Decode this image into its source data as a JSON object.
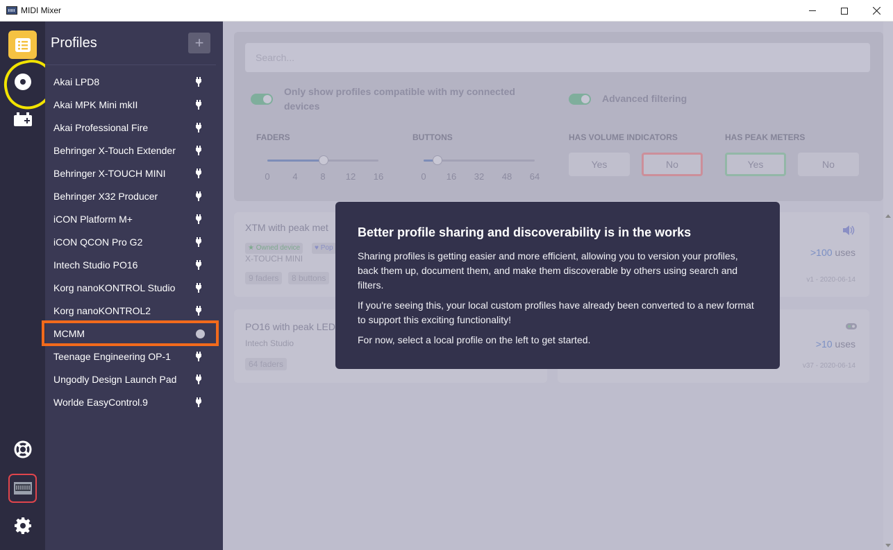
{
  "window": {
    "title": "MIDI Mixer"
  },
  "rail": {
    "items": [
      "profiles-icon",
      "mixer-icon",
      "devices-icon",
      "help-icon",
      "device-image-icon",
      "settings-icon"
    ]
  },
  "sidebar": {
    "title": "Profiles",
    "add_label": "+",
    "items": [
      {
        "label": "Akai LPD8",
        "status": "plug"
      },
      {
        "label": "Akai MPK Mini mkII",
        "status": "plug"
      },
      {
        "label": "Akai Professional Fire",
        "status": "plug"
      },
      {
        "label": "Behringer X-Touch Extender",
        "status": "plug"
      },
      {
        "label": "Behringer X-TOUCH MINI",
        "status": "plug"
      },
      {
        "label": "Behringer X32 Producer",
        "status": "plug"
      },
      {
        "label": "iCON Platform M+",
        "status": "plug"
      },
      {
        "label": "iCON QCON Pro G2",
        "status": "plug"
      },
      {
        "label": "Intech Studio PO16",
        "status": "plug"
      },
      {
        "label": "Korg nanoKONTROL Studio",
        "status": "plug"
      },
      {
        "label": "Korg nanoKONTROL2",
        "status": "plug"
      },
      {
        "label": "MCMM",
        "status": "dot",
        "selected": true
      },
      {
        "label": "Teenage Engineering OP-1",
        "status": "plug"
      },
      {
        "label": "Ungodly Design Launch Pad",
        "status": "plug"
      },
      {
        "label": "Worlde EasyControl.9",
        "status": "plug"
      }
    ]
  },
  "filters": {
    "search_placeholder": "Search...",
    "compat_label": "Only show profiles compatible with my connected devices",
    "advanced_label": "Advanced filtering",
    "faders_head": "FADERS",
    "faders_ticks": [
      "0",
      "4",
      "8",
      "12",
      "16"
    ],
    "buttons_head": "BUTTONS",
    "buttons_ticks": [
      "0",
      "16",
      "32",
      "48",
      "64"
    ],
    "volume_head": "HAS VOLUME INDICATORS",
    "volume_yes": "Yes",
    "volume_no": "No",
    "peak_head": "HAS PEAK METERS",
    "peak_yes": "Yes",
    "peak_no": "No"
  },
  "cards": [
    {
      "title": "XTM with peak met",
      "tag_owned": "Owned device",
      "tag_popular": "Pop",
      "subtitle": "X-TOUCH MINI",
      "chip1": "9 faders",
      "chip2": "8 buttons",
      "uses_num": ">100",
      "uses_word": "uses",
      "version": "v1 - 2020-06-14"
    },
    {
      "title": "PO16 with peak LED",
      "subtitle": "Intech Studio",
      "chip1": "64 faders",
      "uses_num": ">10",
      "uses_word": "uses",
      "version": "v37 - 2020-06-14"
    }
  ],
  "modal": {
    "title": "Better profile sharing and discoverability is in the works",
    "p1": "Sharing profiles is getting easier and more efficient, allowing you to version your profiles, back them up, document them, and make them discoverable by others using search and filters.",
    "p2": "If you're seeing this, your local custom profiles have already been converted to a new format to support this exciting functionality!",
    "p3": "For now, select a local profile on the left to get started."
  }
}
